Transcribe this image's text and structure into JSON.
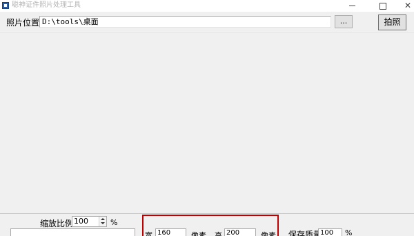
{
  "window": {
    "title": "聪神证件照片处理工具",
    "icon": "app-icon",
    "controls": {
      "minimize_icon": "minimize-icon",
      "maximize_icon": "maximize-icon",
      "close_glyph": "✕"
    }
  },
  "toolbar": {
    "path_label": "照片位置",
    "path_value": "D:\\tools\\桌面",
    "browse_label": "...",
    "capture_label": "拍照"
  },
  "zoom": {
    "label": "缩放比例",
    "value": "100",
    "unit": "%"
  },
  "size": {
    "width_label": "宽",
    "width_value": "160",
    "width_unit": "像素",
    "height_label": "高",
    "height_value": "200",
    "height_unit": "像素",
    "highlight_color": "#c00000"
  },
  "quality": {
    "label": "保存质量",
    "value": "100",
    "unit": "%"
  }
}
